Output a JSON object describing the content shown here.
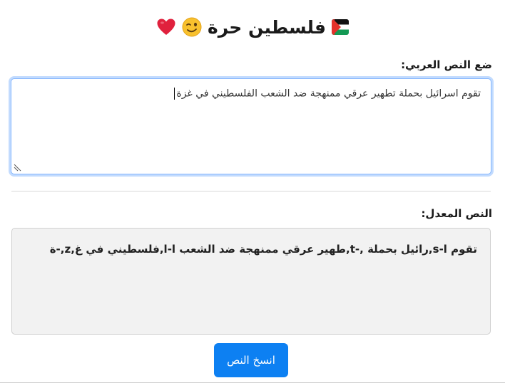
{
  "header": {
    "title": "فلسطين حرة",
    "icons": [
      "palestine-flag-icon",
      "winking-face-icon",
      "heart-icon"
    ]
  },
  "input": {
    "label": "ضع النص العربي:",
    "value": "تقوم اسرائيل بحملة تطهير عرقي ممنهجة ضد الشعب الفلسطيني في غزة"
  },
  "output": {
    "label": "النص المعدل:",
    "text": "تقوم ا-s,رائيل بحملة ,-t,طهير عرقي ممنهجة ضد الشعب ا-l,فلسطيني في غ,z,-ة"
  },
  "actions": {
    "copy_label": "انسخ النص"
  },
  "colors": {
    "accent": "#0d80f2",
    "focus_border": "#86b7fe",
    "output_bg": "#f2f2f2"
  }
}
